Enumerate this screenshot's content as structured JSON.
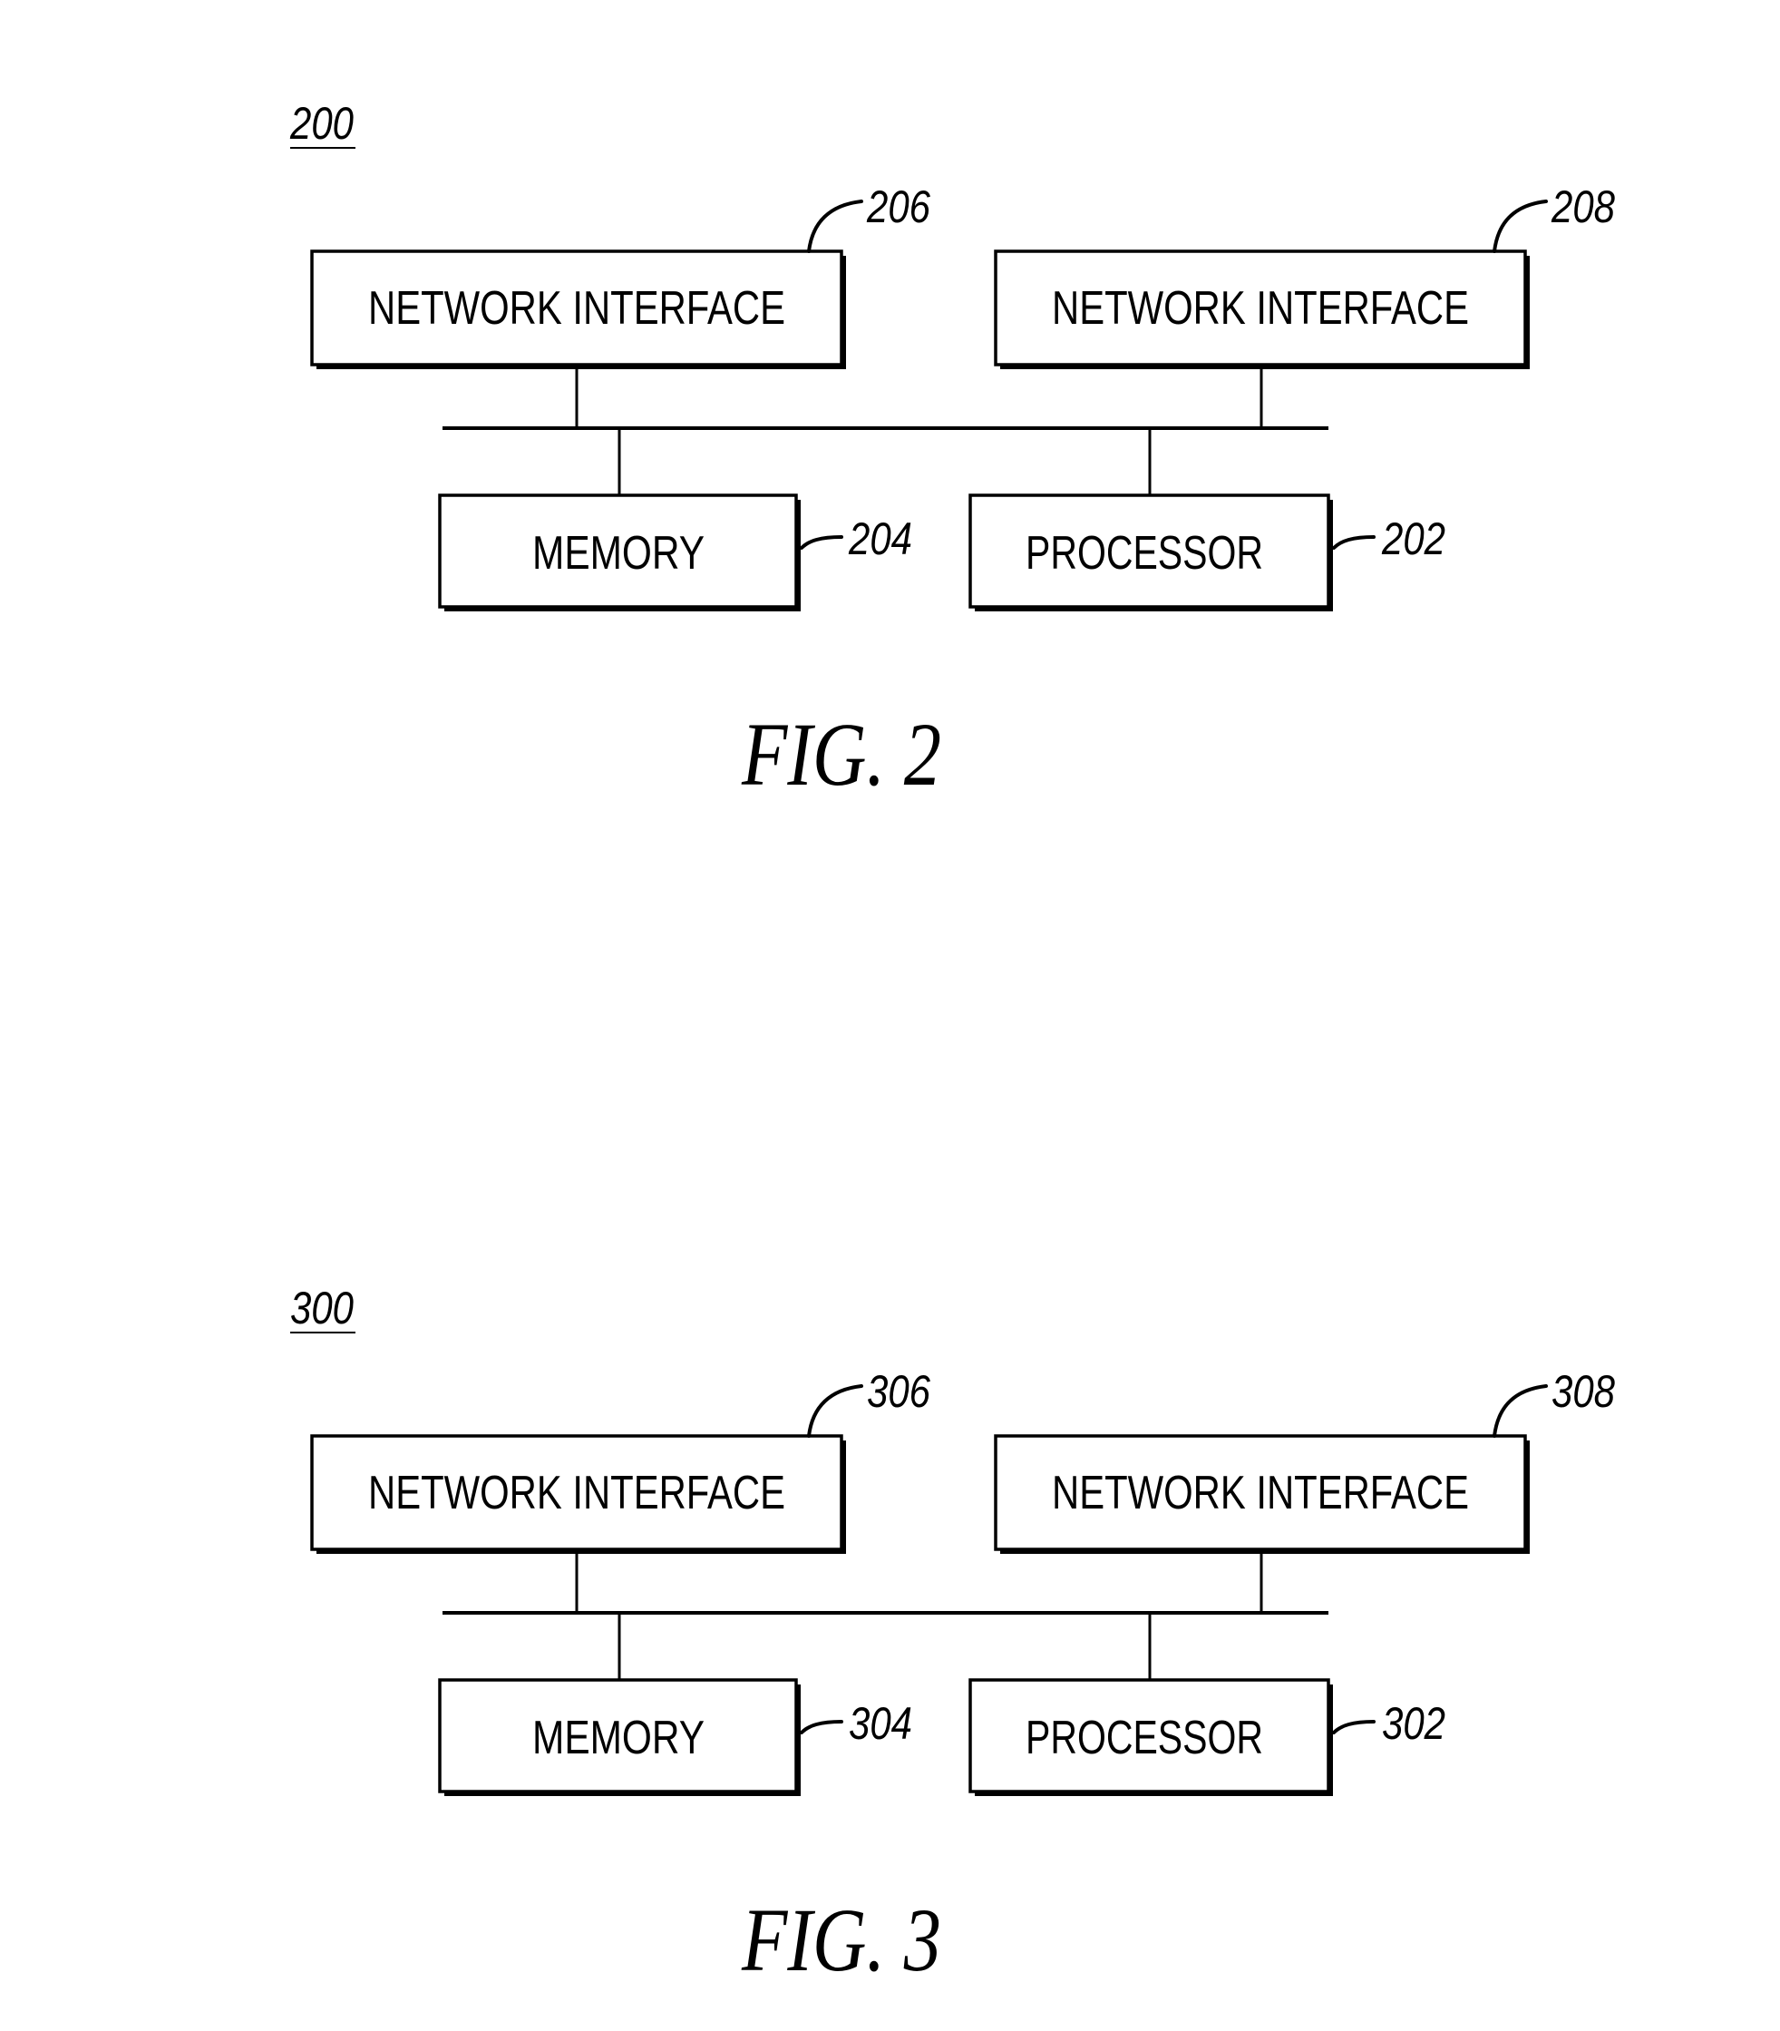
{
  "figures": [
    {
      "id": "fig2",
      "figure_number": "200",
      "caption": "FIG. 2",
      "components": {
        "network_interface_left": {
          "label": "NETWORK INTERFACE",
          "ref": "206"
        },
        "network_interface_right": {
          "label": "NETWORK INTERFACE",
          "ref": "208"
        },
        "memory": {
          "label": "MEMORY",
          "ref": "204"
        },
        "processor": {
          "label": "PROCESSOR",
          "ref": "202"
        }
      },
      "connections": [
        {
          "from": "network_interface_left",
          "to": "bus"
        },
        {
          "from": "network_interface_right",
          "to": "bus"
        },
        {
          "from": "memory",
          "to": "bus"
        },
        {
          "from": "processor",
          "to": "bus"
        }
      ]
    },
    {
      "id": "fig3",
      "figure_number": "300",
      "caption": "FIG. 3",
      "components": {
        "network_interface_left": {
          "label": "NETWORK INTERFACE",
          "ref": "306"
        },
        "network_interface_right": {
          "label": "NETWORK INTERFACE",
          "ref": "308"
        },
        "memory": {
          "label": "MEMORY",
          "ref": "304"
        },
        "processor": {
          "label": "PROCESSOR",
          "ref": "302"
        }
      },
      "connections": [
        {
          "from": "network_interface_left",
          "to": "bus"
        },
        {
          "from": "network_interface_right",
          "to": "bus"
        },
        {
          "from": "memory",
          "to": "bus"
        },
        {
          "from": "processor",
          "to": "bus"
        }
      ]
    }
  ]
}
